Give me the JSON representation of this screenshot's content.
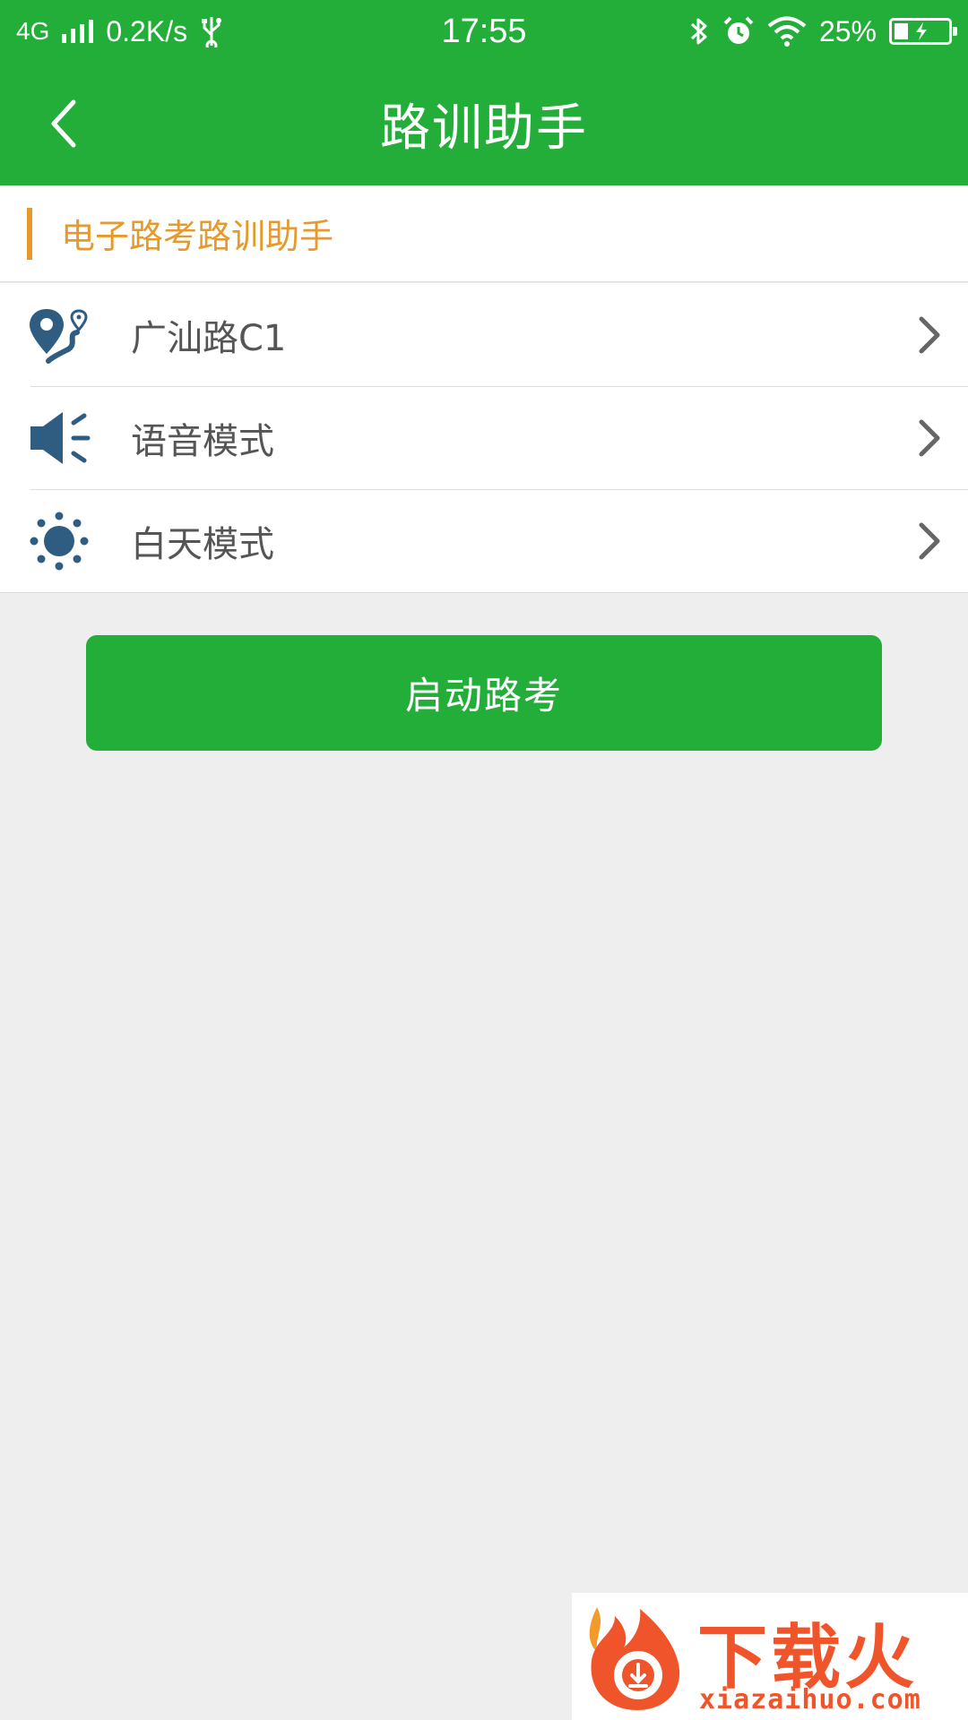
{
  "status_bar": {
    "network": "4G",
    "speed": "0.2K/s",
    "time": "17:55",
    "battery_text": "25%",
    "battery_level": 0.25
  },
  "header": {
    "title": "路训助手"
  },
  "section": {
    "title": "电子路考路训助手"
  },
  "list": {
    "items": [
      {
        "label": "广汕路C1",
        "icon": "route-pin-icon"
      },
      {
        "label": "语音模式",
        "icon": "speaker-icon"
      },
      {
        "label": "白天模式",
        "icon": "sun-icon"
      }
    ]
  },
  "actions": {
    "start_label": "启动路考"
  },
  "watermark": {
    "brand": "下载火",
    "url": "xiazaihuo.com"
  },
  "colors": {
    "primary_green": "#23ae3a",
    "accent_orange": "#e69a2e",
    "icon_blue": "#2f5d82",
    "watermark_red": "#f0542a"
  }
}
